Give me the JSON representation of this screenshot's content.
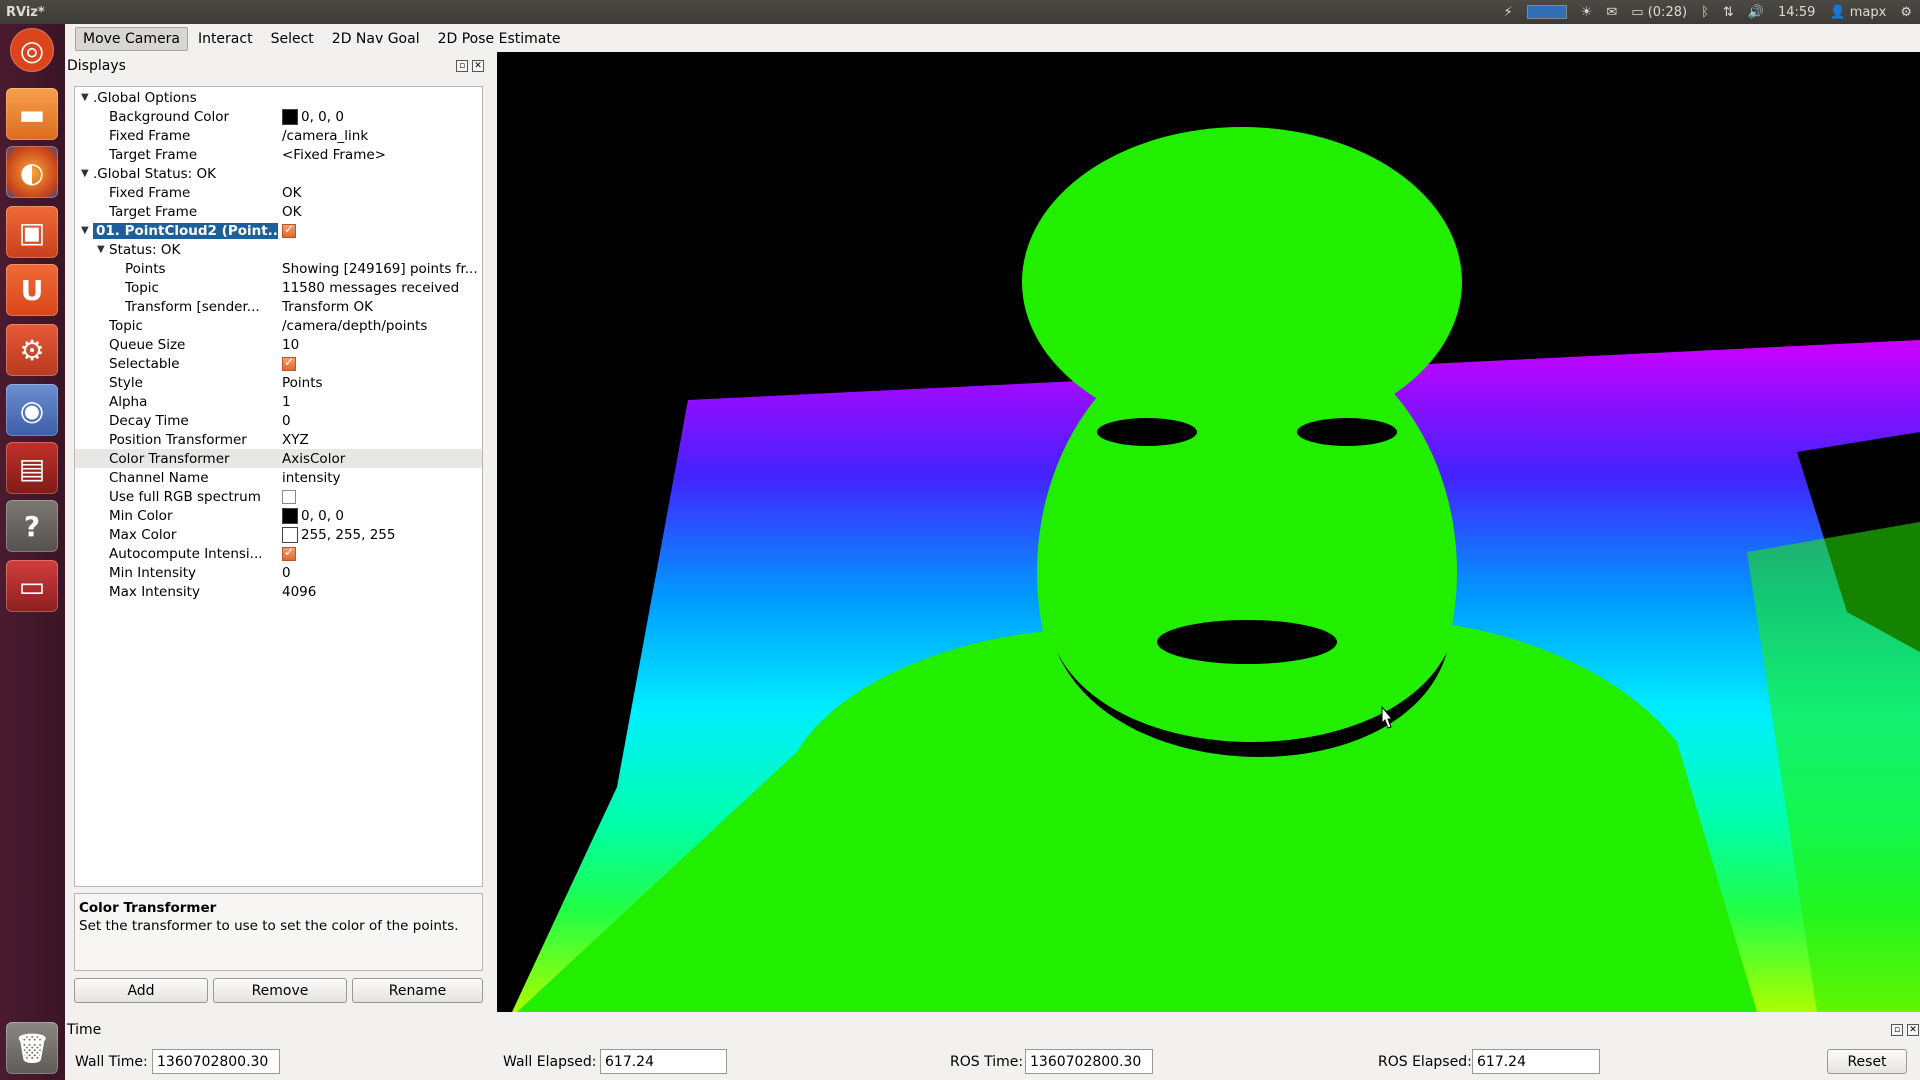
{
  "window_title": "RViz*",
  "panel": {
    "clock": "14:59",
    "battery": "(0:28)",
    "user": "mapx"
  },
  "toolbar": {
    "tools": [
      "Move Camera",
      "Interact",
      "Select",
      "2D Nav Goal",
      "2D Pose Estimate"
    ],
    "active": "Move Camera"
  },
  "displays": {
    "title": "Displays",
    "rows": [
      {
        "level": 0,
        "arrow": true,
        "name": ".Global Options",
        "value": ""
      },
      {
        "level": 1,
        "name": "Background Color",
        "value": "0, 0, 0",
        "swatch": "#000000"
      },
      {
        "level": 1,
        "name": "Fixed Frame",
        "value": "/camera_link"
      },
      {
        "level": 1,
        "name": "Target Frame",
        "value": "<Fixed Frame>"
      },
      {
        "level": 0,
        "arrow": true,
        "name": ".Global Status: OK",
        "value": ""
      },
      {
        "level": 1,
        "name": "Fixed Frame",
        "value": "OK"
      },
      {
        "level": 1,
        "name": "Target Frame",
        "value": "OK"
      },
      {
        "level": 0,
        "arrow": true,
        "name": "01. PointCloud2 (Point...",
        "value": "",
        "checkbox": true,
        "selected": true
      },
      {
        "level": 1,
        "arrow": true,
        "name": "Status: OK",
        "value": ""
      },
      {
        "level": 2,
        "name": "Points",
        "value": "Showing [249169] points fr..."
      },
      {
        "level": 2,
        "name": "Topic",
        "value": "11580 messages received"
      },
      {
        "level": 2,
        "name": "Transform [sender...",
        "value": "Transform OK"
      },
      {
        "level": 1,
        "name": "Topic",
        "value": "/camera/depth/points"
      },
      {
        "level": 1,
        "name": "Queue Size",
        "value": "10"
      },
      {
        "level": 1,
        "name": "Selectable",
        "value": "",
        "checkbox": true
      },
      {
        "level": 1,
        "name": "Style",
        "value": "Points"
      },
      {
        "level": 1,
        "name": "Alpha",
        "value": "1"
      },
      {
        "level": 1,
        "name": "Decay Time",
        "value": "0"
      },
      {
        "level": 1,
        "name": "Position Transformer",
        "value": "XYZ"
      },
      {
        "level": 1,
        "name": "Color Transformer",
        "value": "AxisColor",
        "highlight": true
      },
      {
        "level": 1,
        "name": "Channel Name",
        "value": "intensity"
      },
      {
        "level": 1,
        "name": "Use full RGB spectrum",
        "value": "",
        "checkbox": false
      },
      {
        "level": 1,
        "name": "Min Color",
        "value": "0, 0, 0",
        "swatch": "#000000"
      },
      {
        "level": 1,
        "name": "Max Color",
        "value": "255, 255, 255",
        "swatch": "#ffffff"
      },
      {
        "level": 1,
        "name": "Autocompute Intensi...",
        "value": "",
        "checkbox": true
      },
      {
        "level": 1,
        "name": "Min Intensity",
        "value": "0"
      },
      {
        "level": 1,
        "name": "Max Intensity",
        "value": "4096"
      }
    ],
    "help_title": "Color Transformer",
    "help_text": "Set the transformer to use to set the color of the points.",
    "buttons": {
      "add": "Add",
      "remove": "Remove",
      "rename": "Rename"
    }
  },
  "time": {
    "title": "Time",
    "wall_time_label": "Wall Time:",
    "wall_time": "1360702800.30",
    "wall_elapsed_label": "Wall Elapsed:",
    "wall_elapsed": "617.24",
    "ros_time_label": "ROS Time:",
    "ros_time": "1360702800.30",
    "ros_elapsed_label": "ROS Elapsed:",
    "ros_elapsed": "617.24",
    "reset": "Reset"
  },
  "colors": {
    "selection": "#1d5f9b",
    "checkbox": "#e2672b",
    "view_background": "#000000",
    "cloud_foreground": "#22ee00"
  }
}
